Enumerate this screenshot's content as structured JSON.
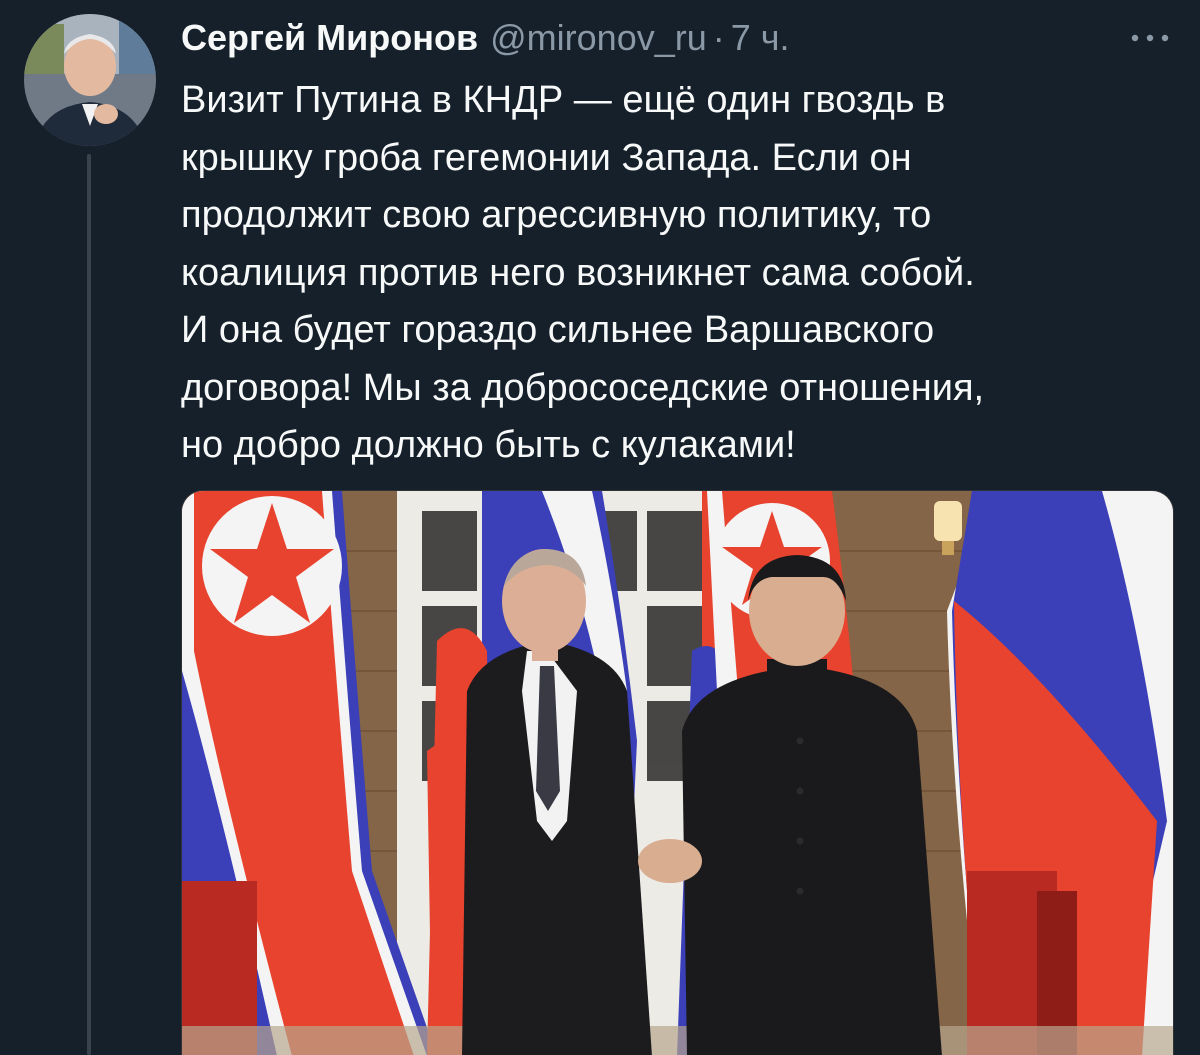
{
  "tweet": {
    "author": {
      "name": "Сергей Миронов",
      "handle": "@mironov_ru",
      "avatar_icon": "profile-photo"
    },
    "separator": "·",
    "timestamp": "7 ч.",
    "more_icon": "more-horizontal-icon",
    "text": "Визит Путина в КНДР — ещё один гвоздь в\nкрышку гроба гегемонии Запада. Если он\nпродолжит свою агрессивную политику, то\nкоалиция против него возникнет сама собой.\nИ она будет гораздо сильнее Варшавского\nдоговора! Мы за добрососедские отношения,\nно добро должно быть с кулаками!",
    "media": {
      "type": "photo"
    }
  },
  "colors": {
    "background": "#15202b",
    "text_primary": "#f7f9f9",
    "text_secondary": "#8b98a5",
    "thread_line": "#38444d",
    "flag_red": "#e8432e",
    "flag_blue": "#3b3fb8",
    "flag_white": "#f4f4f4",
    "suit": "#1c1c1e",
    "wall": "#8b6a4c"
  }
}
